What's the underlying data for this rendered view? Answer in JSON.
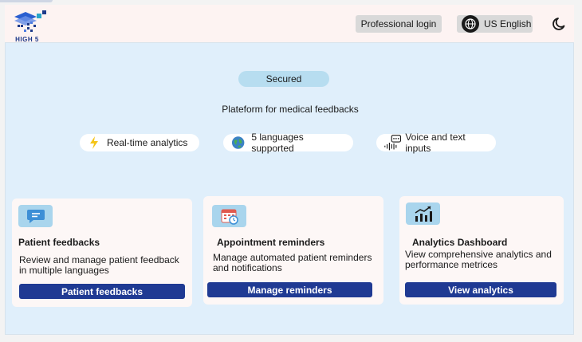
{
  "header": {
    "logo_text": "HIGH 5",
    "professional_login": "Professional login",
    "language": "US English"
  },
  "hero": {
    "badge": "Secured",
    "tagline": "Plateform for medical feedbacks"
  },
  "features": [
    {
      "icon": "lightning-icon",
      "label": "Real-time analytics"
    },
    {
      "icon": "globe-icon",
      "label": "5 languages supported"
    },
    {
      "icon": "voice-chat-icon",
      "label": "Voice and text inputs"
    }
  ],
  "cards": [
    {
      "icon": "chat-bubble-icon",
      "title": "Patient feedbacks",
      "description": "Review and manage patient feedback in multiple languages",
      "button": "Patient feedbacks"
    },
    {
      "icon": "calendar-icon",
      "title": "Appointment reminders",
      "description": "Manage automated patient reminders and notifications",
      "button": "Manage reminders"
    },
    {
      "icon": "bar-chart-icon",
      "title": "Analytics Dashboard",
      "description": "View comprehensive analytics and performance metrices",
      "button": "View analytics"
    }
  ],
  "colors": {
    "accent": "#1f3a93",
    "background": "#e0effb",
    "badge": "#b7ddf0",
    "header": "#fdf3f2",
    "card": "#fdf7f6"
  }
}
